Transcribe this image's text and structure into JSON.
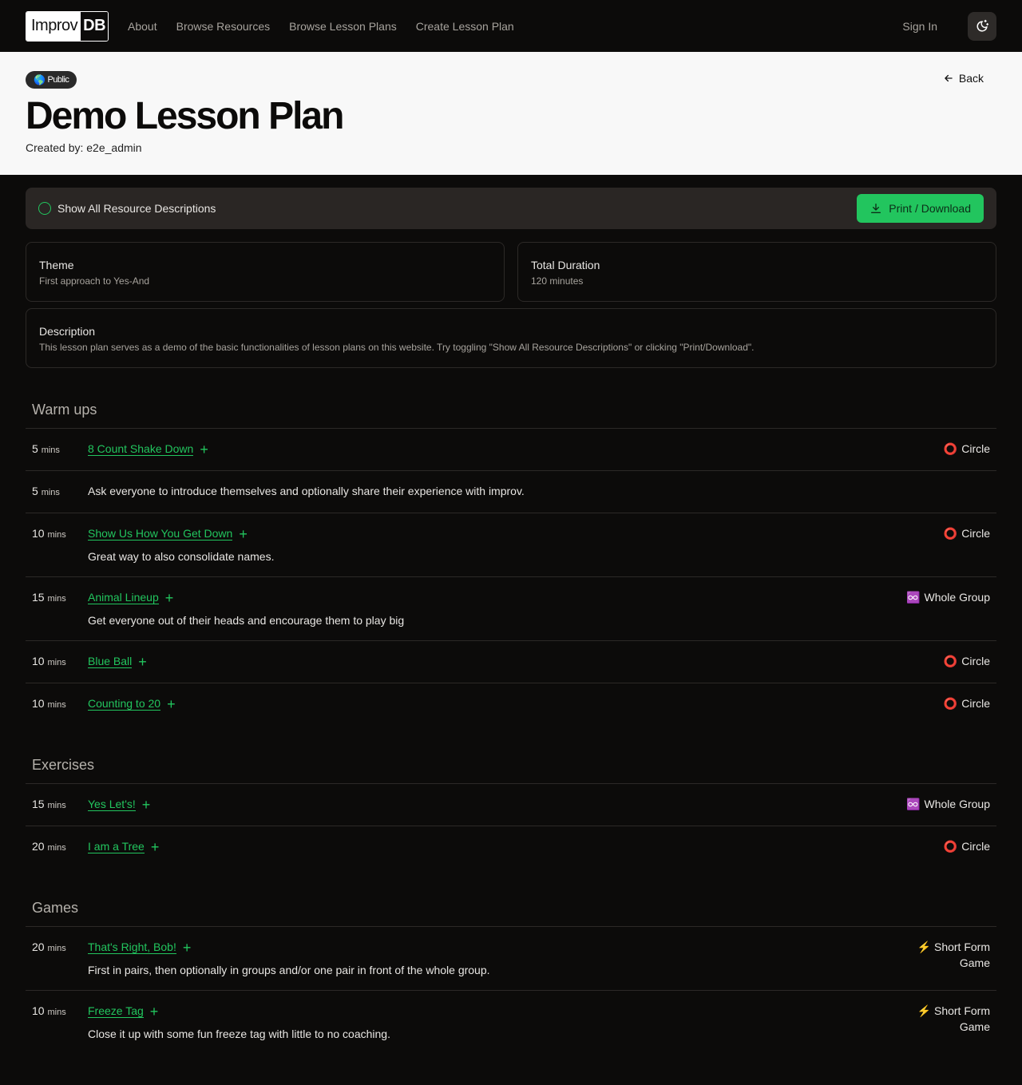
{
  "nav": {
    "logo_left": "Improv",
    "logo_right": "DB",
    "links": [
      "About",
      "Browse Resources",
      "Browse Lesson Plans",
      "Create Lesson Plan"
    ],
    "sign_in": "Sign In"
  },
  "hero": {
    "badge": "Public",
    "title": "Demo Lesson Plan",
    "creator": "Created by: e2e_admin",
    "back": "Back"
  },
  "toolbar": {
    "toggle_label": "Show All Resource Descriptions",
    "print_label": "Print / Download"
  },
  "info": {
    "theme_label": "Theme",
    "theme_value": "First approach to Yes-And",
    "duration_label": "Total Duration",
    "duration_value": "120 minutes",
    "description_label": "Description",
    "description_value": "This lesson plan serves as a demo of the basic functionalities of lesson plans on this website. Try toggling \"Show All Resource Descriptions\" or clicking \"Print/Download\"."
  },
  "unit_label": "mins",
  "sections": [
    {
      "title": "Warm ups",
      "items": [
        {
          "duration": "5",
          "resource": "8 Count Shake Down",
          "note": "",
          "tag": "Circle",
          "tag_icon": "⭕"
        },
        {
          "duration": "5",
          "resource": "",
          "note": "Ask everyone to introduce themselves and optionally share their experience with improv.",
          "tag": "",
          "tag_icon": ""
        },
        {
          "duration": "10",
          "resource": "Show Us How You Get Down",
          "note": "Great way to also consolidate names.",
          "tag": "Circle",
          "tag_icon": "⭕"
        },
        {
          "duration": "15",
          "resource": "Animal Lineup",
          "note": "Get everyone out of their heads and encourage them to play big",
          "tag": "Whole Group",
          "tag_icon": "♾️"
        },
        {
          "duration": "10",
          "resource": "Blue Ball",
          "note": "",
          "tag": "Circle",
          "tag_icon": "⭕"
        },
        {
          "duration": "10",
          "resource": "Counting to 20",
          "note": "",
          "tag": "Circle",
          "tag_icon": "⭕"
        }
      ]
    },
    {
      "title": "Exercises",
      "items": [
        {
          "duration": "15",
          "resource": "Yes Let's!",
          "note": "",
          "tag": "Whole Group",
          "tag_icon": "♾️"
        },
        {
          "duration": "20",
          "resource": "I am a Tree",
          "note": "",
          "tag": "Circle",
          "tag_icon": "⭕"
        }
      ]
    },
    {
      "title": "Games",
      "items": [
        {
          "duration": "20",
          "resource": "That's Right, Bob!",
          "note": "First in pairs, then optionally in groups and/or one pair in front of the whole group.",
          "tag": "Short Form Game",
          "tag_icon": "⚡"
        },
        {
          "duration": "10",
          "resource": "Freeze Tag",
          "note": "Close it up with some fun freeze tag with little to no coaching.",
          "tag": "Short Form Game",
          "tag_icon": "⚡"
        }
      ]
    }
  ],
  "colors": {
    "accent": "#22c55e",
    "background": "#0c0b0a",
    "hero_bg": "#f8f8f8"
  }
}
